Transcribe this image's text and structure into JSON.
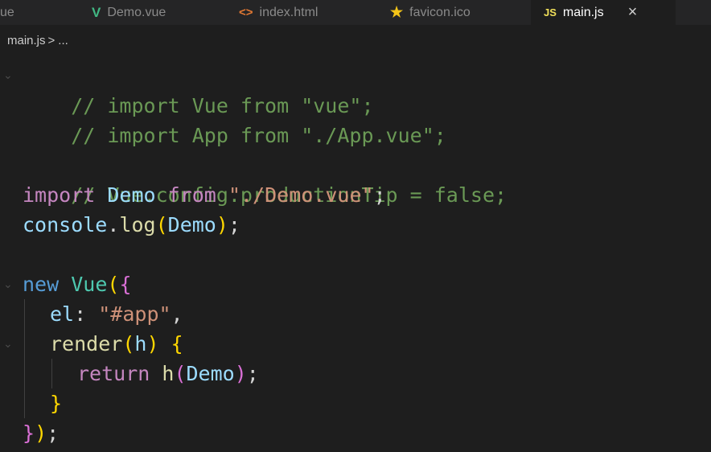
{
  "tabs": [
    {
      "label": "ue",
      "icon": "",
      "icon_name": "",
      "icon_color": "#8a8a8a",
      "active": false
    },
    {
      "label": "Demo.vue",
      "icon": "V",
      "icon_name": "vue-file-icon",
      "icon_color": "#41b883",
      "active": false
    },
    {
      "label": "index.html",
      "icon": "<>",
      "icon_name": "html-file-icon",
      "icon_color": "#e37933",
      "active": false
    },
    {
      "label": "favicon.ico",
      "icon": "★",
      "icon_name": "favicon-star-icon",
      "icon_color": "#f5c518",
      "active": false
    },
    {
      "label": "main.js",
      "icon": "JS",
      "icon_name": "js-file-icon",
      "icon_color": "#f1e05a",
      "active": true,
      "close": "×"
    }
  ],
  "breadcrumb": {
    "file": "main.js",
    "separator": ">",
    "more": "..."
  },
  "code": {
    "line1": {
      "a": "// import Vue from \"vue\";"
    },
    "line2": {
      "a": "// import App from \"./App.vue\";"
    },
    "line4": {
      "a": "// Vue.config.productionTip = false;"
    },
    "line5": {
      "kw": "import",
      "name": "Demo",
      "from": "from",
      "path": "\"./Demo.vue\"",
      "semi": ";"
    },
    "line6": {
      "obj": "console",
      "dot": ".",
      "fn": "log",
      "open": "(",
      "arg": "Demo",
      "close": ")",
      "semi": ";"
    },
    "line8": {
      "kw": "new",
      "cls": "Vue",
      "open": "(",
      "brace": "{"
    },
    "line9": {
      "key": "el",
      "colon": ":",
      "val": "\"#app\"",
      "comma": ","
    },
    "line10": {
      "fn": "render",
      "open": "(",
      "arg": "h",
      "close": ")",
      "brace": "{"
    },
    "line11": {
      "kw": "return",
      "fn": "h",
      "open": "(",
      "arg": "Demo",
      "close": ")",
      "semi": ";"
    },
    "line12": {
      "brace": "}"
    },
    "line13": {
      "brace": "}",
      "close": ")",
      "semi": ";"
    }
  },
  "colors": {
    "editor_bg": "#1e1e1e",
    "tabbar_bg": "#252526",
    "comment": "#6a9955",
    "keyword": "#c586c0",
    "variable": "#9cdcfe",
    "function": "#dcdcaa",
    "string": "#ce9178",
    "class": "#4ec9b0"
  }
}
